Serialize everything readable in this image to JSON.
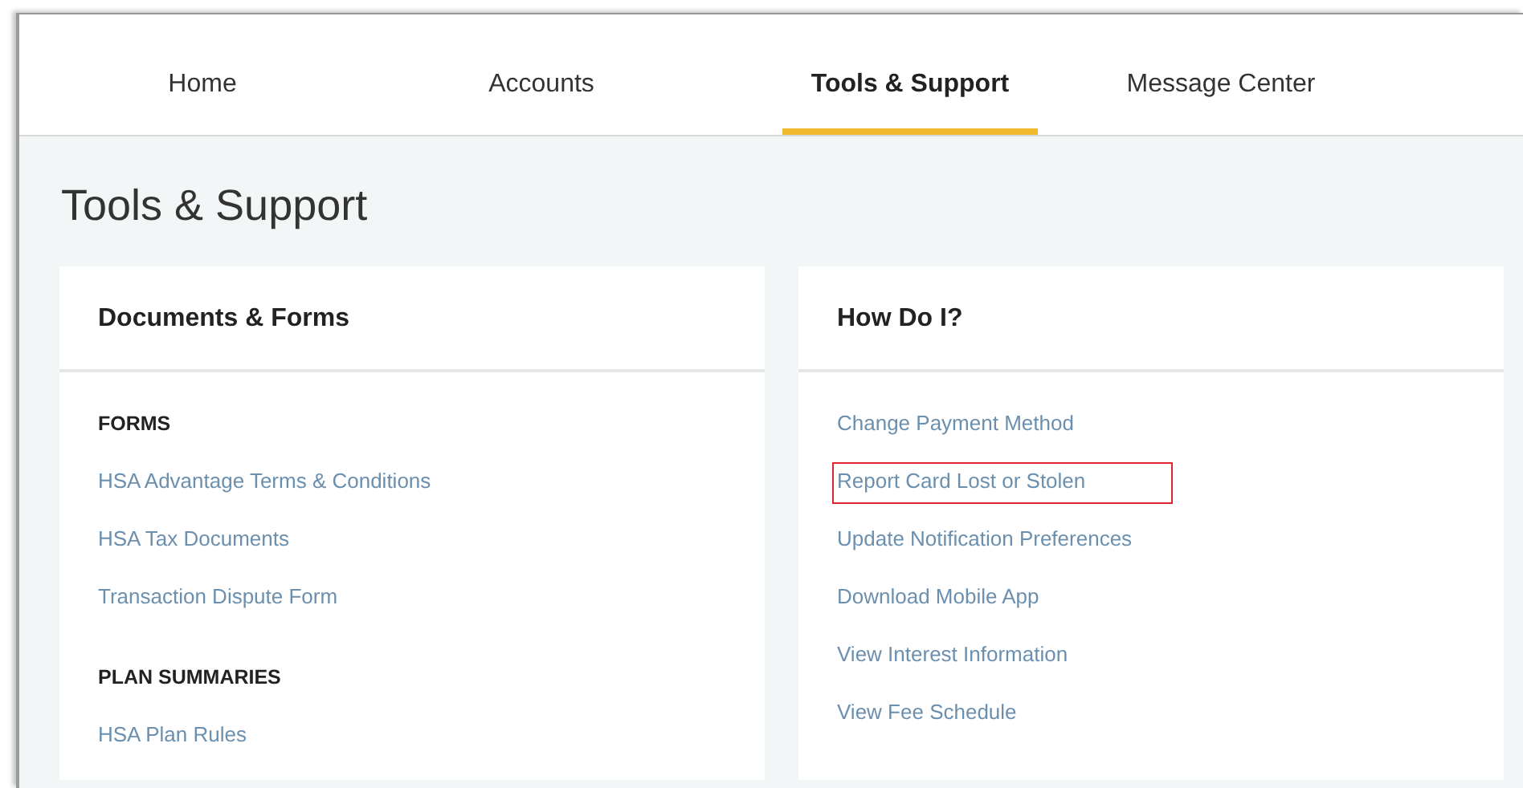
{
  "tabs": [
    {
      "label": "Home",
      "selected": false
    },
    {
      "label": "Accounts",
      "selected": false
    },
    {
      "label": "Tools & Support",
      "selected": true
    },
    {
      "label": "Message Center",
      "selected": false
    }
  ],
  "page_title": "Tools & Support",
  "cards": [
    {
      "title": "Documents & Forms",
      "sections": [
        {
          "heading": "FORMS",
          "links": [
            {
              "label": "HSA Advantage Terms & Conditions",
              "highlighted": false
            },
            {
              "label": "HSA Tax Documents",
              "highlighted": false
            },
            {
              "label": "Transaction Dispute Form",
              "highlighted": false
            }
          ]
        },
        {
          "heading": "PLAN SUMMARIES",
          "links": [
            {
              "label": "HSA Plan Rules",
              "highlighted": false
            }
          ]
        }
      ]
    },
    {
      "title": "How Do I?",
      "sections": [
        {
          "links": [
            {
              "label": "Change Payment Method",
              "highlighted": false
            },
            {
              "label": "Report Card Lost or Stolen",
              "highlighted": true
            },
            {
              "label": "Update Notification Preferences",
              "highlighted": false
            },
            {
              "label": "Download Mobile App",
              "highlighted": false
            },
            {
              "label": "View Interest Information",
              "highlighted": false
            },
            {
              "label": "View Fee Schedule",
              "highlighted": false
            }
          ]
        }
      ]
    }
  ]
}
